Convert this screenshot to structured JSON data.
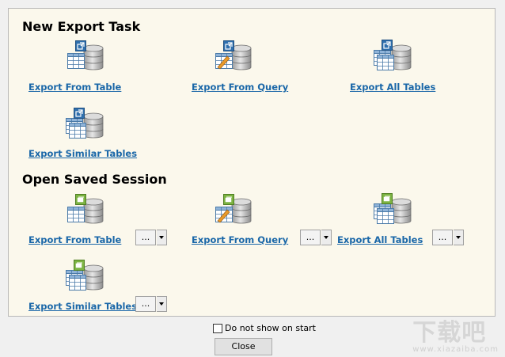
{
  "new_export": {
    "title": "New Export Task",
    "items": [
      {
        "label": "Export From Table",
        "icon": "export-table-icon"
      },
      {
        "label": "Export From Query",
        "icon": "export-query-icon"
      },
      {
        "label": "Export All Tables",
        "icon": "export-all-tables-icon"
      },
      {
        "label": "Export Similar Tables",
        "icon": "export-similar-tables-icon"
      }
    ]
  },
  "saved_session": {
    "title": "Open Saved Session",
    "items": [
      {
        "label": "Export From Table",
        "icon": "session-table-icon",
        "combo": "..."
      },
      {
        "label": "Export From Query",
        "icon": "session-query-icon",
        "combo": "..."
      },
      {
        "label": "Export All Tables",
        "icon": "session-all-tables-icon",
        "combo": "..."
      },
      {
        "label": "Export Similar Tables",
        "icon": "session-similar-tables-icon",
        "combo": "..."
      }
    ]
  },
  "footer": {
    "checkbox_label": "Do not show on start",
    "close_label": "Close"
  },
  "watermark": {
    "big": "下载吧",
    "small": "www.xiazaiba.com"
  },
  "colors": {
    "link": "#1a67a8",
    "panel_bg": "#fbf8ec",
    "new_badge": "#2f6fad",
    "session_badge": "#7cb342"
  }
}
